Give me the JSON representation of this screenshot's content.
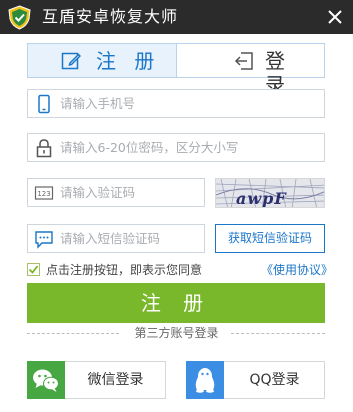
{
  "window": {
    "title": "互盾安卓恢复大师",
    "logo_icon": "shield-logo-icon",
    "close_icon": "close-icon"
  },
  "tabs": [
    {
      "label": "注 册",
      "icon": "edit-icon",
      "active": true
    },
    {
      "label": "登 录",
      "icon": "login-icon",
      "active": false
    }
  ],
  "form": {
    "phone_placeholder": "请输入手机号",
    "password_placeholder": "请输入6-20位密码，区分大小写",
    "captcha_placeholder": "请输入验证码",
    "captcha_text": "awpF",
    "sms_placeholder": "请输入短信验证码",
    "sms_button": "获取短信验证码",
    "agree_checked": true,
    "agree_text": "点击注册按钮，即表示您同意",
    "agree_link": "《使用协议》",
    "register_button": "注 册"
  },
  "third_party": {
    "divider": "第三方账号登录",
    "wechat_label": "微信登录",
    "qq_label": "QQ登录"
  },
  "colors": {
    "titlebar": "#2b2b2b",
    "accent_blue": "#1b76c7",
    "register_green": "#78b82a",
    "wechat_green": "#47a742",
    "qq_blue": "#3b8ee3"
  }
}
